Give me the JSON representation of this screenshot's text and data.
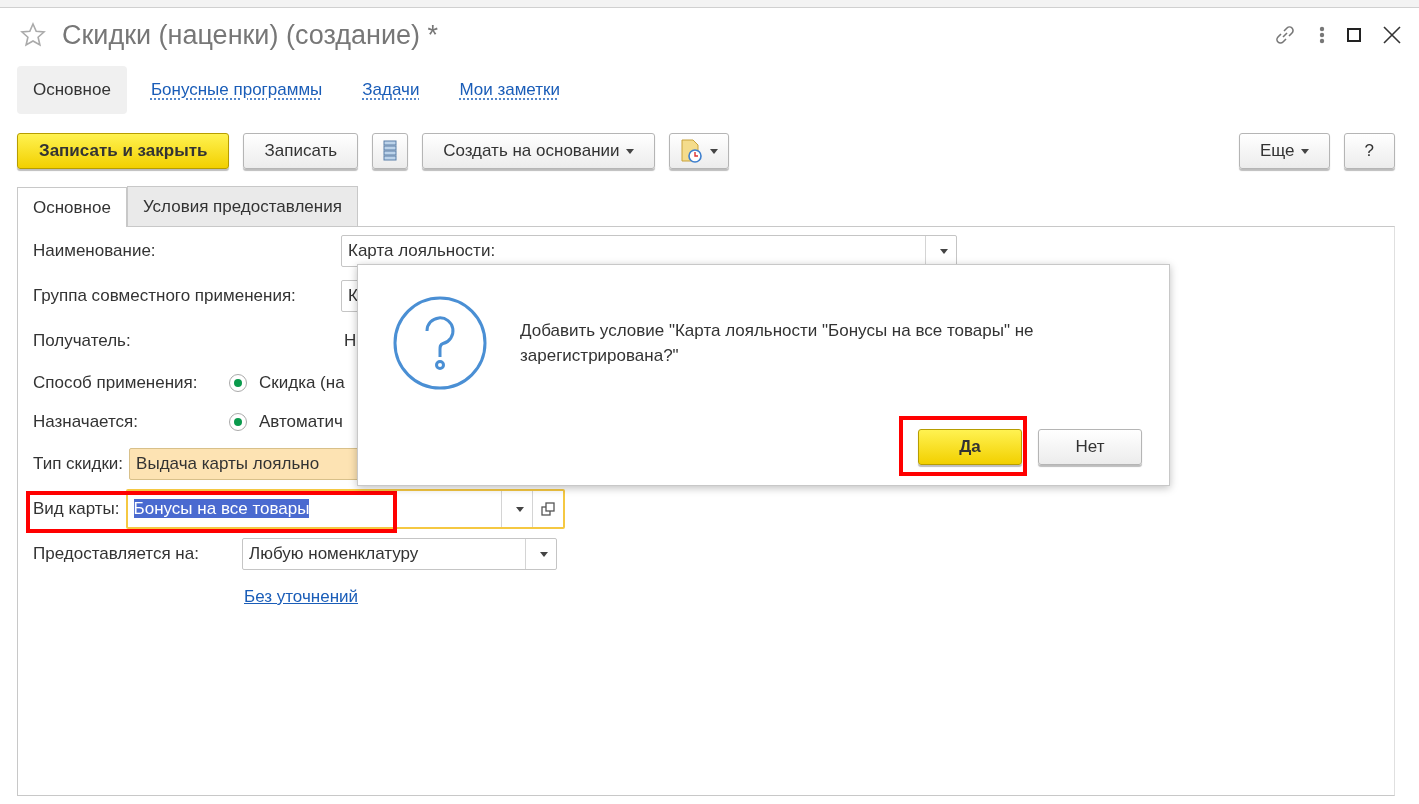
{
  "window": {
    "title": "Скидки (наценки) (создание) *"
  },
  "nav_tabs": [
    {
      "label": "Основное",
      "selected": true
    },
    {
      "label": "Бонусные программы",
      "selected": false
    },
    {
      "label": "Задачи",
      "selected": false
    },
    {
      "label": "Мои заметки",
      "selected": false
    }
  ],
  "toolbar": {
    "left": [
      {
        "kind": "primary",
        "label": "Записать и закрыть"
      },
      {
        "kind": "plain",
        "label": "Записать"
      },
      {
        "kind": "structure"
      },
      {
        "kind": "menu",
        "label": "Создать на основании"
      },
      {
        "kind": "report"
      }
    ],
    "right": [
      {
        "kind": "menu",
        "label": "Еще"
      },
      {
        "kind": "plain",
        "label": "?"
      }
    ]
  },
  "form_tabs": [
    {
      "label": "Основное",
      "selected": true
    },
    {
      "label": "Условия предоставления",
      "selected": false
    }
  ],
  "fields": [
    {
      "kind": "combo",
      "label": "Наименование:",
      "value": "Карта лояльности:"
    },
    {
      "kind": "combo",
      "label": "Группа совместного применения:",
      "value": "К"
    },
    {
      "kind": "text",
      "label": "Получатель:",
      "value": "Н"
    },
    {
      "kind": "radio",
      "label": "Способ применения:",
      "option": "Скидка (на",
      "selected": true
    },
    {
      "kind": "radio",
      "label": "Назначается:",
      "option": "Автоматич",
      "selected": true
    },
    {
      "kind": "readonly",
      "label": "Тип скидки:",
      "value": "Выдача карты лояльно"
    },
    {
      "kind": "card",
      "label": "Вид карты:",
      "value": "Бонусы на все товары",
      "highlighted": true
    },
    {
      "kind": "combo",
      "label": "Предоставляется на:",
      "value": "Любую номенклатуру"
    }
  ],
  "link": "Без уточнений",
  "dialog": {
    "message": "Добавить условие \"Карта лояльности \"Бонусы на все товары\" не зарегистрирована?\"",
    "buttons": [
      {
        "kind": "default",
        "label": "Да",
        "highlighted": true
      },
      {
        "kind": "plain",
        "label": "Нет"
      }
    ]
  }
}
